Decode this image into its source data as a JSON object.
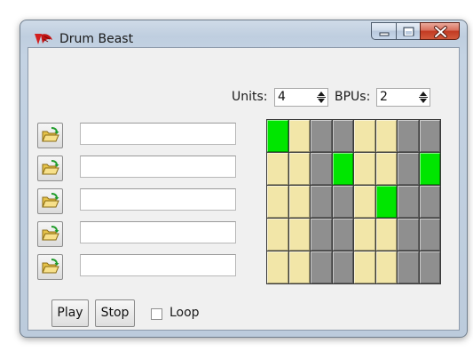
{
  "window": {
    "title": "Drum Beast",
    "app_icon": "tk-feather-icon",
    "caption_buttons": [
      "minimize",
      "maximize",
      "close"
    ]
  },
  "controls": {
    "units_label": "Units:",
    "units_value": "4",
    "bpus_label": "BPUs:",
    "bpus_value": "2"
  },
  "tracks": [
    {
      "file": ""
    },
    {
      "file": ""
    },
    {
      "file": ""
    },
    {
      "file": ""
    },
    {
      "file": ""
    }
  ],
  "open_button_icon": "folder-open-icon",
  "beat_grid": {
    "columns": 8,
    "rows": 5,
    "cells": [
      [
        "on",
        "beige",
        "gray",
        "gray",
        "beige",
        "beige",
        "gray",
        "gray"
      ],
      [
        "beige",
        "beige",
        "gray",
        "on",
        "beige",
        "beige",
        "gray",
        "on"
      ],
      [
        "beige",
        "beige",
        "gray",
        "gray",
        "beige",
        "on",
        "gray",
        "gray"
      ],
      [
        "beige",
        "beige",
        "gray",
        "gray",
        "beige",
        "beige",
        "gray",
        "gray"
      ],
      [
        "beige",
        "beige",
        "gray",
        "gray",
        "beige",
        "beige",
        "gray",
        "gray"
      ]
    ],
    "colors": {
      "on": "#00e600",
      "beige": "#f2e6a8",
      "gray": "#8f8f8f"
    }
  },
  "buttons": {
    "play_label": "Play",
    "stop_label": "Stop",
    "loop_label": "Loop",
    "loop_checked": false
  },
  "colors": {
    "window_bg": "#f0f0f0",
    "frame": "#bfcedf",
    "close_red": "#c23a22"
  }
}
